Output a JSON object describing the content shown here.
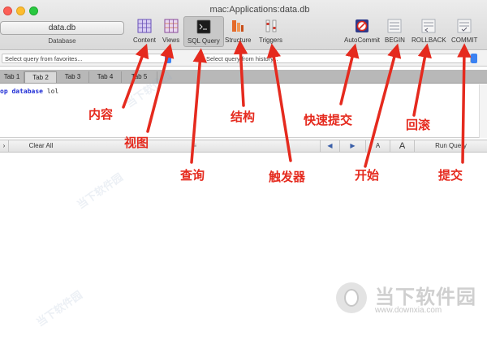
{
  "window": {
    "title": "mac:Applications:data.db",
    "db_name": "data.db",
    "db_caption": "Database"
  },
  "toolbar": {
    "content": "Content",
    "views": "Views",
    "sql_query": "SQL Query",
    "structure": "Structure",
    "triggers": "Triggers",
    "autocommit": "AutoCommit",
    "begin": "BEGIN",
    "rollback": "ROLLBACK",
    "commit": "COMMIT"
  },
  "query_bar": {
    "favorites_placeholder": "Select query from favorites...",
    "history_placeholder": "Select query from history..."
  },
  "tabs": [
    "Tab 1",
    "Tab 2",
    "Tab 3",
    "Tab 4",
    "Tab 5"
  ],
  "selected_tab": "Tab 2",
  "editor": {
    "keyword": "op database",
    "argument": "lol"
  },
  "bottom_bar": {
    "clear_all": "Clear All",
    "font_small": "A",
    "font_large": "A",
    "run_query": "Run Query"
  },
  "annotations": {
    "content": "内容",
    "views": "视图",
    "query": "查询",
    "structure": "结构",
    "triggers": "触发器",
    "autocommit": "快速提交",
    "begin": "开始",
    "rollback": "回滚",
    "commit": "提交"
  },
  "watermark": {
    "name": "当下软件园",
    "url": "www.downxia.com"
  },
  "colors": {
    "annotation": "#e52a1e",
    "keyword": "#2230d6",
    "close": "#fc5f57",
    "minimize": "#fdbc2e",
    "zoom": "#28c840"
  }
}
